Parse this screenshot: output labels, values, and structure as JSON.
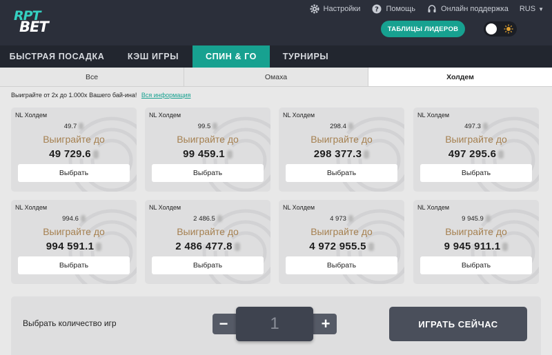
{
  "header": {
    "logo_top": "RPT",
    "logo_bottom": "BET",
    "settings_label": "Настройки",
    "help_label": "Помощь",
    "support_label": "Онлайн поддержка",
    "language": "RUS",
    "leaders_button": "ТАБЛИЦЫ ЛИДЕРОВ",
    "icons": [
      "gear-icon",
      "help-icon",
      "headset-icon",
      "sun-icon"
    ],
    "accent_color": "#17a190"
  },
  "nav": {
    "items": [
      {
        "label": "БЫСТРАЯ ПОСАДКА"
      },
      {
        "label": "КЭШ ИГРЫ"
      },
      {
        "label": "СПИН & ГО"
      },
      {
        "label": "ТУРНИРЫ"
      }
    ],
    "active": "СПИН & ГО"
  },
  "subtabs": {
    "items": [
      {
        "label": "Все"
      },
      {
        "label": "Омаха"
      },
      {
        "label": "Холдем"
      }
    ],
    "active": "Холдем"
  },
  "promo": {
    "text": "Выиграйте от 2x до 1.000x Вашего бай-ина!",
    "link": "Вся информация"
  },
  "cards": [
    {
      "game": "NL Холдем",
      "buyin": "49.7",
      "win_label": "Выиграйте до",
      "prize": "49 729.6",
      "button": "Выбрать"
    },
    {
      "game": "NL Холдем",
      "buyin": "99.5",
      "win_label": "Выиграйте до",
      "prize": "99 459.1",
      "button": "Выбрать"
    },
    {
      "game": "NL Холдем",
      "buyin": "298.4",
      "win_label": "Выиграйте до",
      "prize": "298 377.3",
      "button": "Выбрать"
    },
    {
      "game": "NL Холдем",
      "buyin": "497.3",
      "win_label": "Выиграйте до",
      "prize": "497 295.6",
      "button": "Выбрать"
    },
    {
      "game": "NL Холдем",
      "buyin": "994.6",
      "win_label": "Выиграйте до",
      "prize": "994 591.1",
      "button": "Выбрать"
    },
    {
      "game": "NL Холдем",
      "buyin": "2 486.5",
      "win_label": "Выиграйте до",
      "prize": "2 486 477.8",
      "button": "Выбрать"
    },
    {
      "game": "NL Холдем",
      "buyin": "4 973",
      "win_label": "Выиграйте до",
      "prize": "4 972 955.5",
      "button": "Выбрать"
    },
    {
      "game": "NL Холдем",
      "buyin": "9 945.9",
      "win_label": "Выиграйте до",
      "prize": "9 945 911.1",
      "button": "Выбрать"
    }
  ],
  "bottom": {
    "qty_label": "Выбрать количество игр",
    "minus": "−",
    "quantity": "1",
    "plus": "+",
    "play_button": "ИГРАТЬ СЕЙЧАС"
  }
}
